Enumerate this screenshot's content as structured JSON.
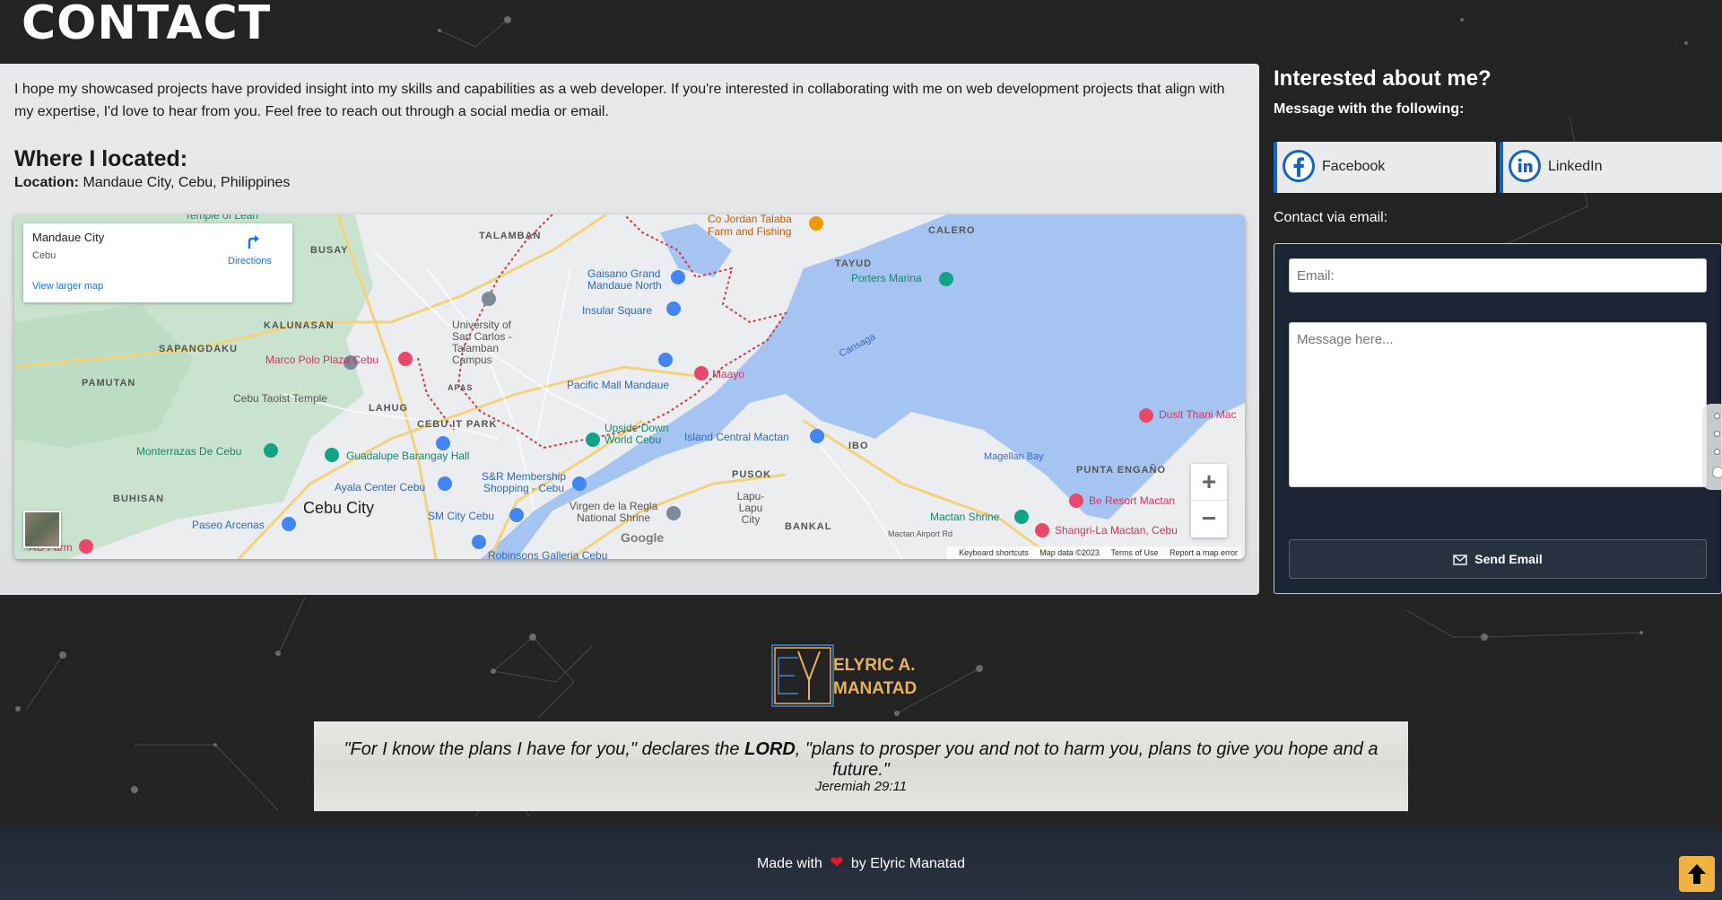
{
  "page": {
    "title": "CONTACT"
  },
  "about": {
    "intro": "I hope my showcased projects have provided insight into my skills and capabilities as a web developer. If you're interested in collaborating with me on web development projects that align with my expertise, I'd love to hear from you. Feel free to reach out through a social media or email.",
    "where_title": "Where I located:",
    "location_label": "Location:",
    "location_value": "Mandaue City, Cebu, Philippines"
  },
  "map": {
    "card": {
      "place": "Mandaue City",
      "region": "Cebu",
      "directions": "Directions",
      "view_larger": "View larger map"
    },
    "labels": {
      "talamban": "TALAMBAN",
      "calero": "CALERO",
      "busay": "BUSAY",
      "tayud": "TAYUD",
      "kalunasan": "KALUNASAN",
      "sapangdaku": "SAPANGDAKU",
      "pamutan": "PAMUTAN",
      "lahug": "LAHUG",
      "apas": "APAS",
      "cebu_it_park": "CEBU IT PARK",
      "ibo": "IBO",
      "pusok": "PUSOK",
      "buhisan": "BUHISAN",
      "bankal": "BANKAL",
      "punta_engano": "PUNTA ENGAÑO",
      "cebu_city": "Cebu City",
      "lapu_lapu": "Lapu-Lapu City",
      "co_jordan": "Co Jordan Talaba Farm and Fishing",
      "gaisano": "Gaisano Grand Mandaue North",
      "porters": "Porters Marina",
      "insular": "Insular Square",
      "usc": "University of San Carlos - Talamban Campus",
      "marco_polo": "Marco Polo Plaza Cebu",
      "taoist": "Cebu Taoist Temple",
      "pacific": "Pacific Mall Mandaue",
      "maayo": "Maayo",
      "upside_down": "Upside Down World Cebu",
      "island_central": "Island Central Mactan",
      "monterrazas": "Monterrazas De Cebu",
      "guadalupe": "Guadalupe Barangay Hall",
      "ayala": "Ayala Center Cebu",
      "snr": "S&R Membership Shopping - Cebu",
      "virgen": "Virgen de la Regla National Shrine",
      "sm": "SM City Cebu",
      "paseo": "Paseo Arcenas",
      "dusit": "Dusit Thani Mac",
      "magellan": "Magellan Bay",
      "be_resort": "Be Resort Mactan",
      "mactan_shrine": "Mactan Shrine",
      "shangri": "Shangri-La Mactan, Cebu",
      "mactan_airport": "Mactan Airport Rd",
      "canal": "Cansaga",
      "temple_leah": "Temple of Leah",
      "ao_farm": "AO Farm",
      "robinsons": "Robinsons Galleria Cebu"
    },
    "footer": {
      "shortcuts": "Keyboard shortcuts",
      "data": "Map data ©2023",
      "terms": "Terms of Use",
      "report": "Report a map error"
    },
    "google": "Google",
    "zoom_in": "+",
    "zoom_out": "−"
  },
  "contact": {
    "title": "Interested about me?",
    "subtitle": "Message with the following:",
    "facebook": "Facebook",
    "linkedin": "LinkedIn",
    "email_label": "Contact via email:",
    "email_placeholder": "Email:",
    "message_placeholder": "Message here...",
    "send": "Send Email"
  },
  "brand": {
    "line1": "ELYRIC A.",
    "line2": "MANATAD"
  },
  "quote": {
    "before": "\"For I know the plans I have for you,\" declares the ",
    "lord": "LORD",
    "after": ", \"plans to prosper you and not to harm you, plans to give you hope and a future.\"",
    "reference": "Jeremiah 29:11"
  },
  "footer": {
    "made_with": "Made with",
    "by": "by Elyric Manatad"
  },
  "colors": {
    "accent_gold": "#f0b341",
    "brand_blue": "#1565c0",
    "heart": "#e21b2c"
  }
}
